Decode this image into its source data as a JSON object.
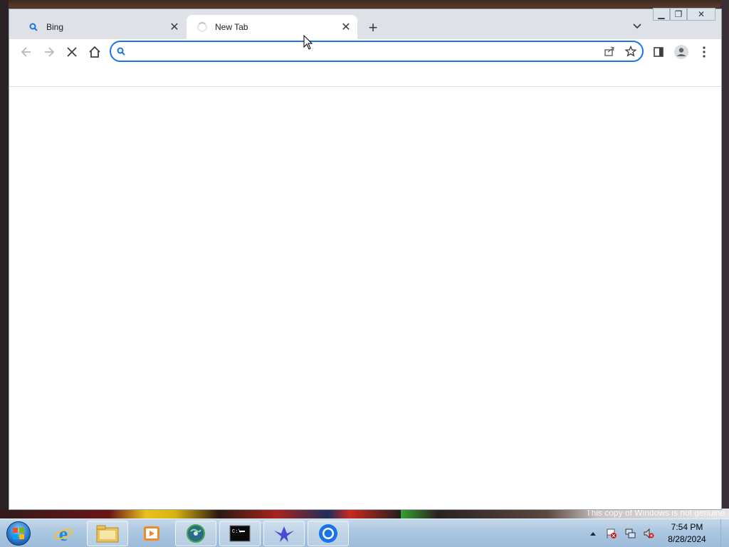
{
  "browser": {
    "tabs": [
      {
        "title": "Bing",
        "icon": "search-icon",
        "state": "inactive"
      },
      {
        "title": "New Tab",
        "icon": "loading-spinner-icon",
        "state": "active"
      }
    ],
    "omnibox": {
      "value": "",
      "placeholder": ""
    },
    "toolbar": {
      "icons": [
        "back-arrow-icon",
        "forward-arrow-icon",
        "stop-icon",
        "home-icon",
        "share-icon",
        "star-icon",
        "side-panel-icon",
        "profile-icon",
        "more-menu-icon"
      ]
    }
  },
  "desktop": {
    "watermark": "This copy of Windows is not genuine"
  },
  "taskbar": {
    "apps": [
      "internet-explorer-icon",
      "file-explorer-icon",
      "media-player-icon",
      "network-globe-icon",
      "command-prompt-icon",
      "app-bird-icon",
      "chrome-icon"
    ],
    "clock": {
      "time": "7:54 PM",
      "date": "8/28/2024"
    }
  }
}
